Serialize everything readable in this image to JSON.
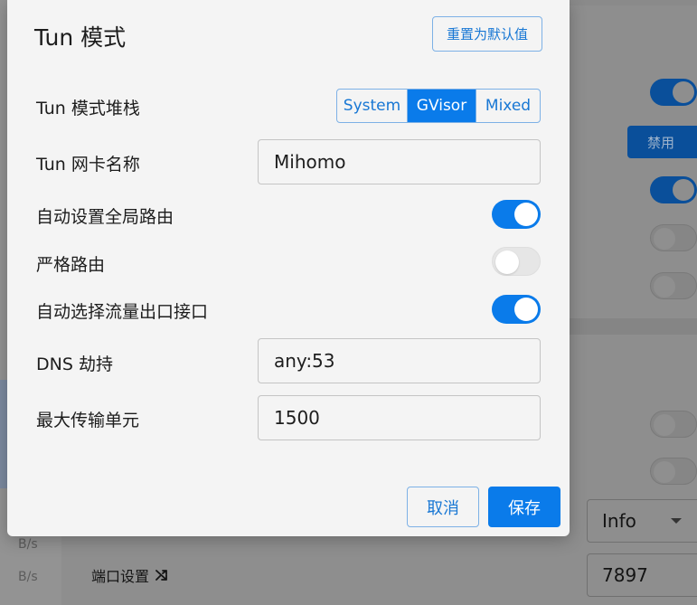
{
  "background": {
    "speed_units": [
      "B/s",
      "B/s"
    ],
    "disable_label": "禁用",
    "log_level": "Info",
    "port_label": "端口设置",
    "port_value": "7897"
  },
  "dialog": {
    "title": "Tun 模式",
    "reset_label": "重置为默认值",
    "stack": {
      "label": "Tun 模式堆栈",
      "options": [
        "System",
        "GVisor",
        "Mixed"
      ],
      "selected": "GVisor"
    },
    "device": {
      "label": "Tun 网卡名称",
      "value": "Mihomo"
    },
    "auto_route": {
      "label": "自动设置全局路由",
      "enabled": true
    },
    "strict_route": {
      "label": "严格路由",
      "enabled": false
    },
    "auto_detect_interface": {
      "label": "自动选择流量出口接口",
      "enabled": true
    },
    "dns_hijack": {
      "label": "DNS 劫持",
      "value": "any:53"
    },
    "mtu": {
      "label": "最大传输单元",
      "value": "1500"
    },
    "cancel_label": "取消",
    "save_label": "保存"
  },
  "colors": {
    "accent": "#0a7bea",
    "accent_outline": "#7db1e6",
    "dialog_bg": "#f4f4f4",
    "overlay_bg": "#8e8e8e"
  }
}
